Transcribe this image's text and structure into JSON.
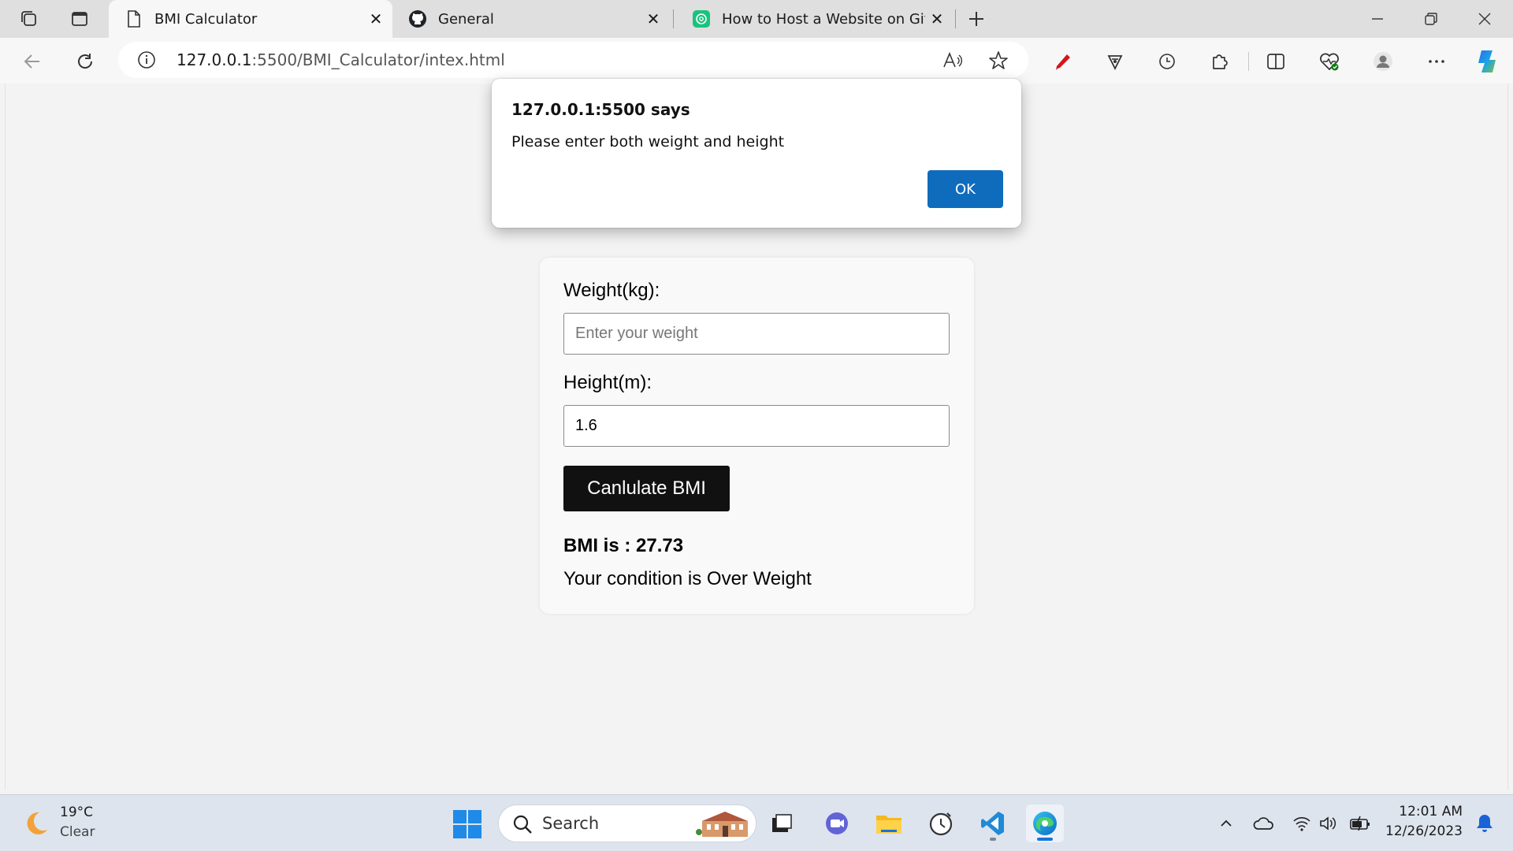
{
  "browser": {
    "tabs": [
      {
        "title": "BMI Calculator",
        "favicon": "page-icon",
        "active": true
      },
      {
        "title": "General",
        "favicon": "github-icon",
        "active": false
      },
      {
        "title": "How to Host a Website on GitHu",
        "favicon": "chatgpt-icon",
        "active": false
      }
    ],
    "url_host": "127.0.0.1",
    "url_path": ":5500/BMI_Calculator/intex.html"
  },
  "dialog": {
    "title": "127.0.0.1:5500 says",
    "message": "Please enter both weight and height",
    "ok_label": "OK",
    "accent": "#0f6cbd"
  },
  "form": {
    "weight_label": "Weight(kg):",
    "weight_placeholder": "Enter your weight",
    "weight_value": "",
    "height_label": "Height(m):",
    "height_value": "1.6",
    "button_label": "Canlulate BMI",
    "result": "BMI is : 27.73",
    "condition": "Your condition is Over Weight"
  },
  "taskbar": {
    "temperature": "19°C",
    "weather": "Clear",
    "search_placeholder": "Search",
    "time": "12:01 AM",
    "date": "12/26/2023"
  }
}
